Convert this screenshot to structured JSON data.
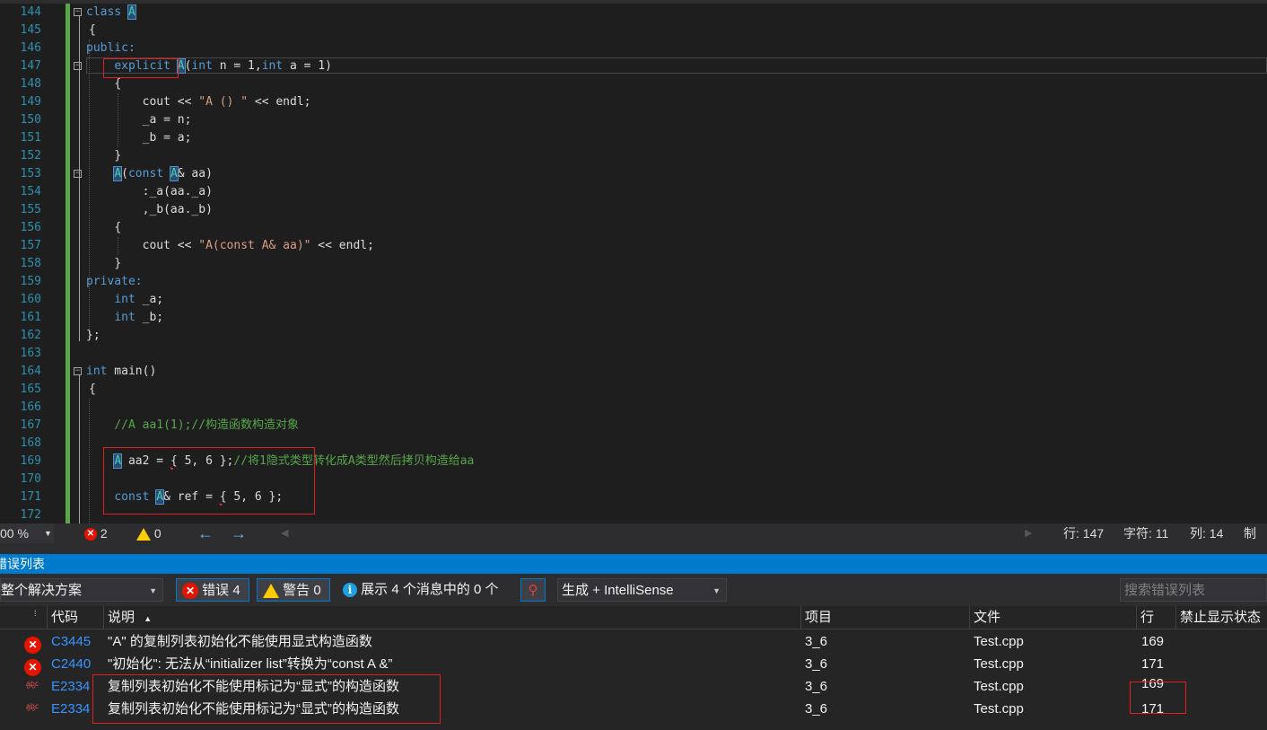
{
  "editor": {
    "line_numbers": [
      "144",
      "145",
      "146",
      "147",
      "148",
      "149",
      "150",
      "151",
      "152",
      "153",
      "154",
      "155",
      "156",
      "157",
      "158",
      "159",
      "160",
      "161",
      "162",
      "163",
      "164",
      "165",
      "166",
      "167",
      "168",
      "169",
      "170",
      "171",
      "172"
    ],
    "lines": {
      "l144": [
        "class ",
        "A"
      ],
      "l146": [
        "public:"
      ],
      "l147": [
        "explicit",
        " ",
        "A",
        "(",
        "int",
        " n = 1,",
        "int",
        " a = 1)"
      ],
      "l149": [
        "cout << ",
        "\"A () \"",
        " << endl;"
      ],
      "l150": [
        "_a = n;"
      ],
      "l151": [
        "_b = a;"
      ],
      "l153": [
        "A",
        "(",
        "const",
        " ",
        "A",
        "& aa)"
      ],
      "l154": [
        ":_a(aa._a)"
      ],
      "l155": [
        ",_b(aa._b)"
      ],
      "l157": [
        "cout << ",
        "\"A(const A& aa)\"",
        " << endl;"
      ],
      "l159": [
        "private:"
      ],
      "l160": [
        "int",
        " _a;"
      ],
      "l161": [
        "int",
        " _b;"
      ],
      "l162": [
        "};"
      ],
      "l164": [
        "int",
        " main()"
      ],
      "l167": [
        "//A aa1(1);//构造函数构造对象"
      ],
      "l169": [
        "A",
        " aa2 = ",
        "{",
        " 5, 6 };",
        "//将1隐式类型转化成A类型然后拷贝构造给aa"
      ],
      "l171": [
        "const",
        " ",
        "A",
        "& ref = ",
        "{",
        " 5, 6 };"
      ]
    },
    "braces": {
      "open": "{",
      "close": "}"
    }
  },
  "status_bar": {
    "zoom": "00 %",
    "errors": "2",
    "warnings": "0",
    "line": "行: 147",
    "char": "字符: 11",
    "col": "列: 14",
    "tab": "制表"
  },
  "error_list": {
    "title": "错误列表",
    "scope": "整个解决方案",
    "errors_btn": "错误 4",
    "warnings_btn": "警告 0",
    "messages_btn": "展示 4 个消息中的 0 个",
    "build_filter": "生成 + IntelliSense",
    "search_placeholder": "搜索错误列表",
    "columns": {
      "code": "代码",
      "desc": "说明",
      "project": "项目",
      "file": "文件",
      "line": "行",
      "suppress": "禁止显示状态"
    },
    "rows": [
      {
        "type": "error",
        "code": "C3445",
        "desc": "\"A\" 的复制列表初始化不能使用显式构造函数",
        "project": "3_6",
        "file": "Test.cpp",
        "line": "169"
      },
      {
        "type": "error",
        "code": "C2440",
        "desc": "\"初始化\": 无法从“initializer list”转换为“const A &”",
        "project": "3_6",
        "file": "Test.cpp",
        "line": "171"
      },
      {
        "type": "intellisense",
        "code": "E2334",
        "desc": "复制列表初始化不能使用标记为“显式”的构造函数",
        "project": "3_6",
        "file": "Test.cpp",
        "line": "169"
      },
      {
        "type": "intellisense",
        "code": "E2334",
        "desc": "复制列表初始化不能使用标记为“显式”的构造函数",
        "project": "3_6",
        "file": "Test.cpp",
        "line": "171"
      }
    ],
    "spell_icon_text": "abc"
  },
  "colors": {
    "accent": "#007acc",
    "error": "#e51400",
    "warning": "#ffcc00",
    "link": "#3794ff",
    "highlight_box": "#e02020"
  }
}
